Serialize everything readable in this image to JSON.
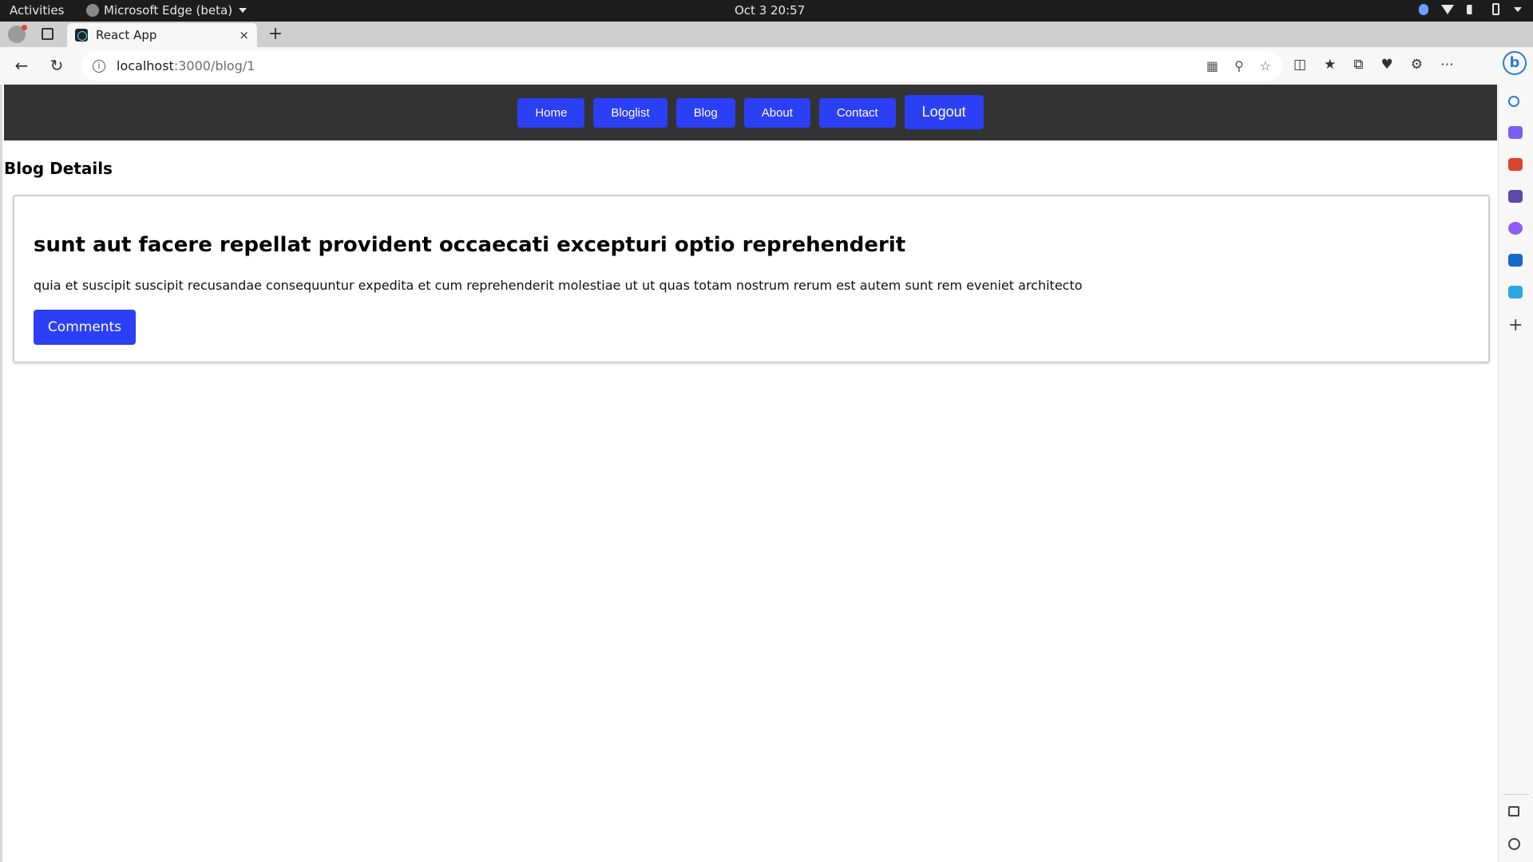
{
  "os": {
    "activities": "Activities",
    "app_name": "Microsoft Edge (beta)",
    "clock": "Oct 3  20:57"
  },
  "browser": {
    "tab_title": "React App",
    "tab_close": "×",
    "new_tab": "+",
    "url_host": "localhost",
    "url_path": ":3000/blog/1"
  },
  "navbar": {
    "home": "Home",
    "bloglist": "Bloglist",
    "blog": "Blog",
    "about": "About",
    "contact": "Contact",
    "logout": "Logout"
  },
  "page": {
    "section_title": "Blog Details",
    "post": {
      "title": "sunt aut facere repellat provident occaecati excepturi optio reprehenderit",
      "body": "quia et suscipit suscipit recusandae consequuntur expedita et cum reprehenderit molestiae ut ut quas totam nostrum rerum est autem sunt rem eveniet architecto",
      "comments_label": "Comments"
    }
  },
  "colors": {
    "navbar_bg": "#333333",
    "button_blue": "#2b3ff5"
  }
}
